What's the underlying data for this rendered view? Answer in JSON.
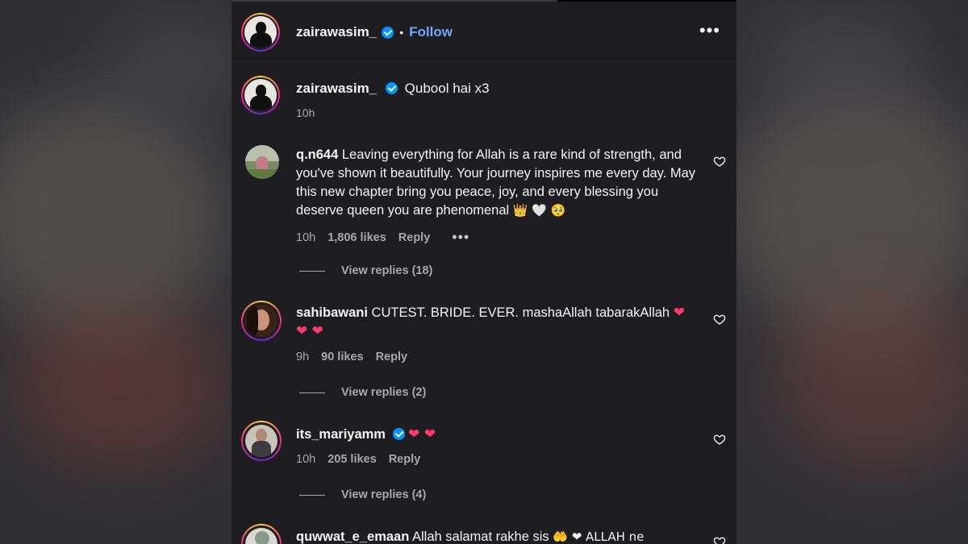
{
  "post": {
    "author": "zairawasim_",
    "follow_label": "Follow",
    "dot_separator": "•",
    "more_label": "•••"
  },
  "caption": {
    "author": "zairawasim_",
    "text": "Qubool hai x3",
    "time": "10h"
  },
  "comments": [
    {
      "username": "q.n644",
      "text": "Leaving everything for Allah is a rare kind of strength, and you've shown it beautifully. Your journey inspires me every day. May this new chapter bring you peace, joy, and every blessing you deserve queen you are phenomenal",
      "emoji": "👑 🤍 🥺",
      "time": "10h",
      "likes": "1,806 likes",
      "reply_label": "Reply",
      "more_label": "•••",
      "view_replies": "View replies (18)"
    },
    {
      "username": "sahibawani",
      "text": "CUTEST. BRIDE. EVER. mashaAllah tabarakAllah",
      "emoji": "❤ ❤ ❤",
      "time": "9h",
      "likes": "90 likes",
      "reply_label": "Reply",
      "view_replies": "View replies (2)"
    },
    {
      "username": "its_mariyamm",
      "text": "",
      "emoji": "❤ ❤",
      "time": "10h",
      "likes": "205 likes",
      "reply_label": "Reply",
      "view_replies": "View replies (4)"
    },
    {
      "username": "quwwat_e_emaan",
      "text": "Allah salamat rakhe sis",
      "emoji": "🤲 ❤ ALLAH ne",
      "time": "",
      "likes": "",
      "reply_label": "",
      "view_replies": ""
    }
  ],
  "colors": {
    "panel_bg": "#1e1e22",
    "follow_blue": "#6ea8ff",
    "verified_blue": "#0095f6",
    "muted_text": "#a8a8a8"
  },
  "icons": {
    "verified": "verified-badge-icon",
    "like": "heart-outline-icon",
    "more": "more-horizontal-icon"
  }
}
